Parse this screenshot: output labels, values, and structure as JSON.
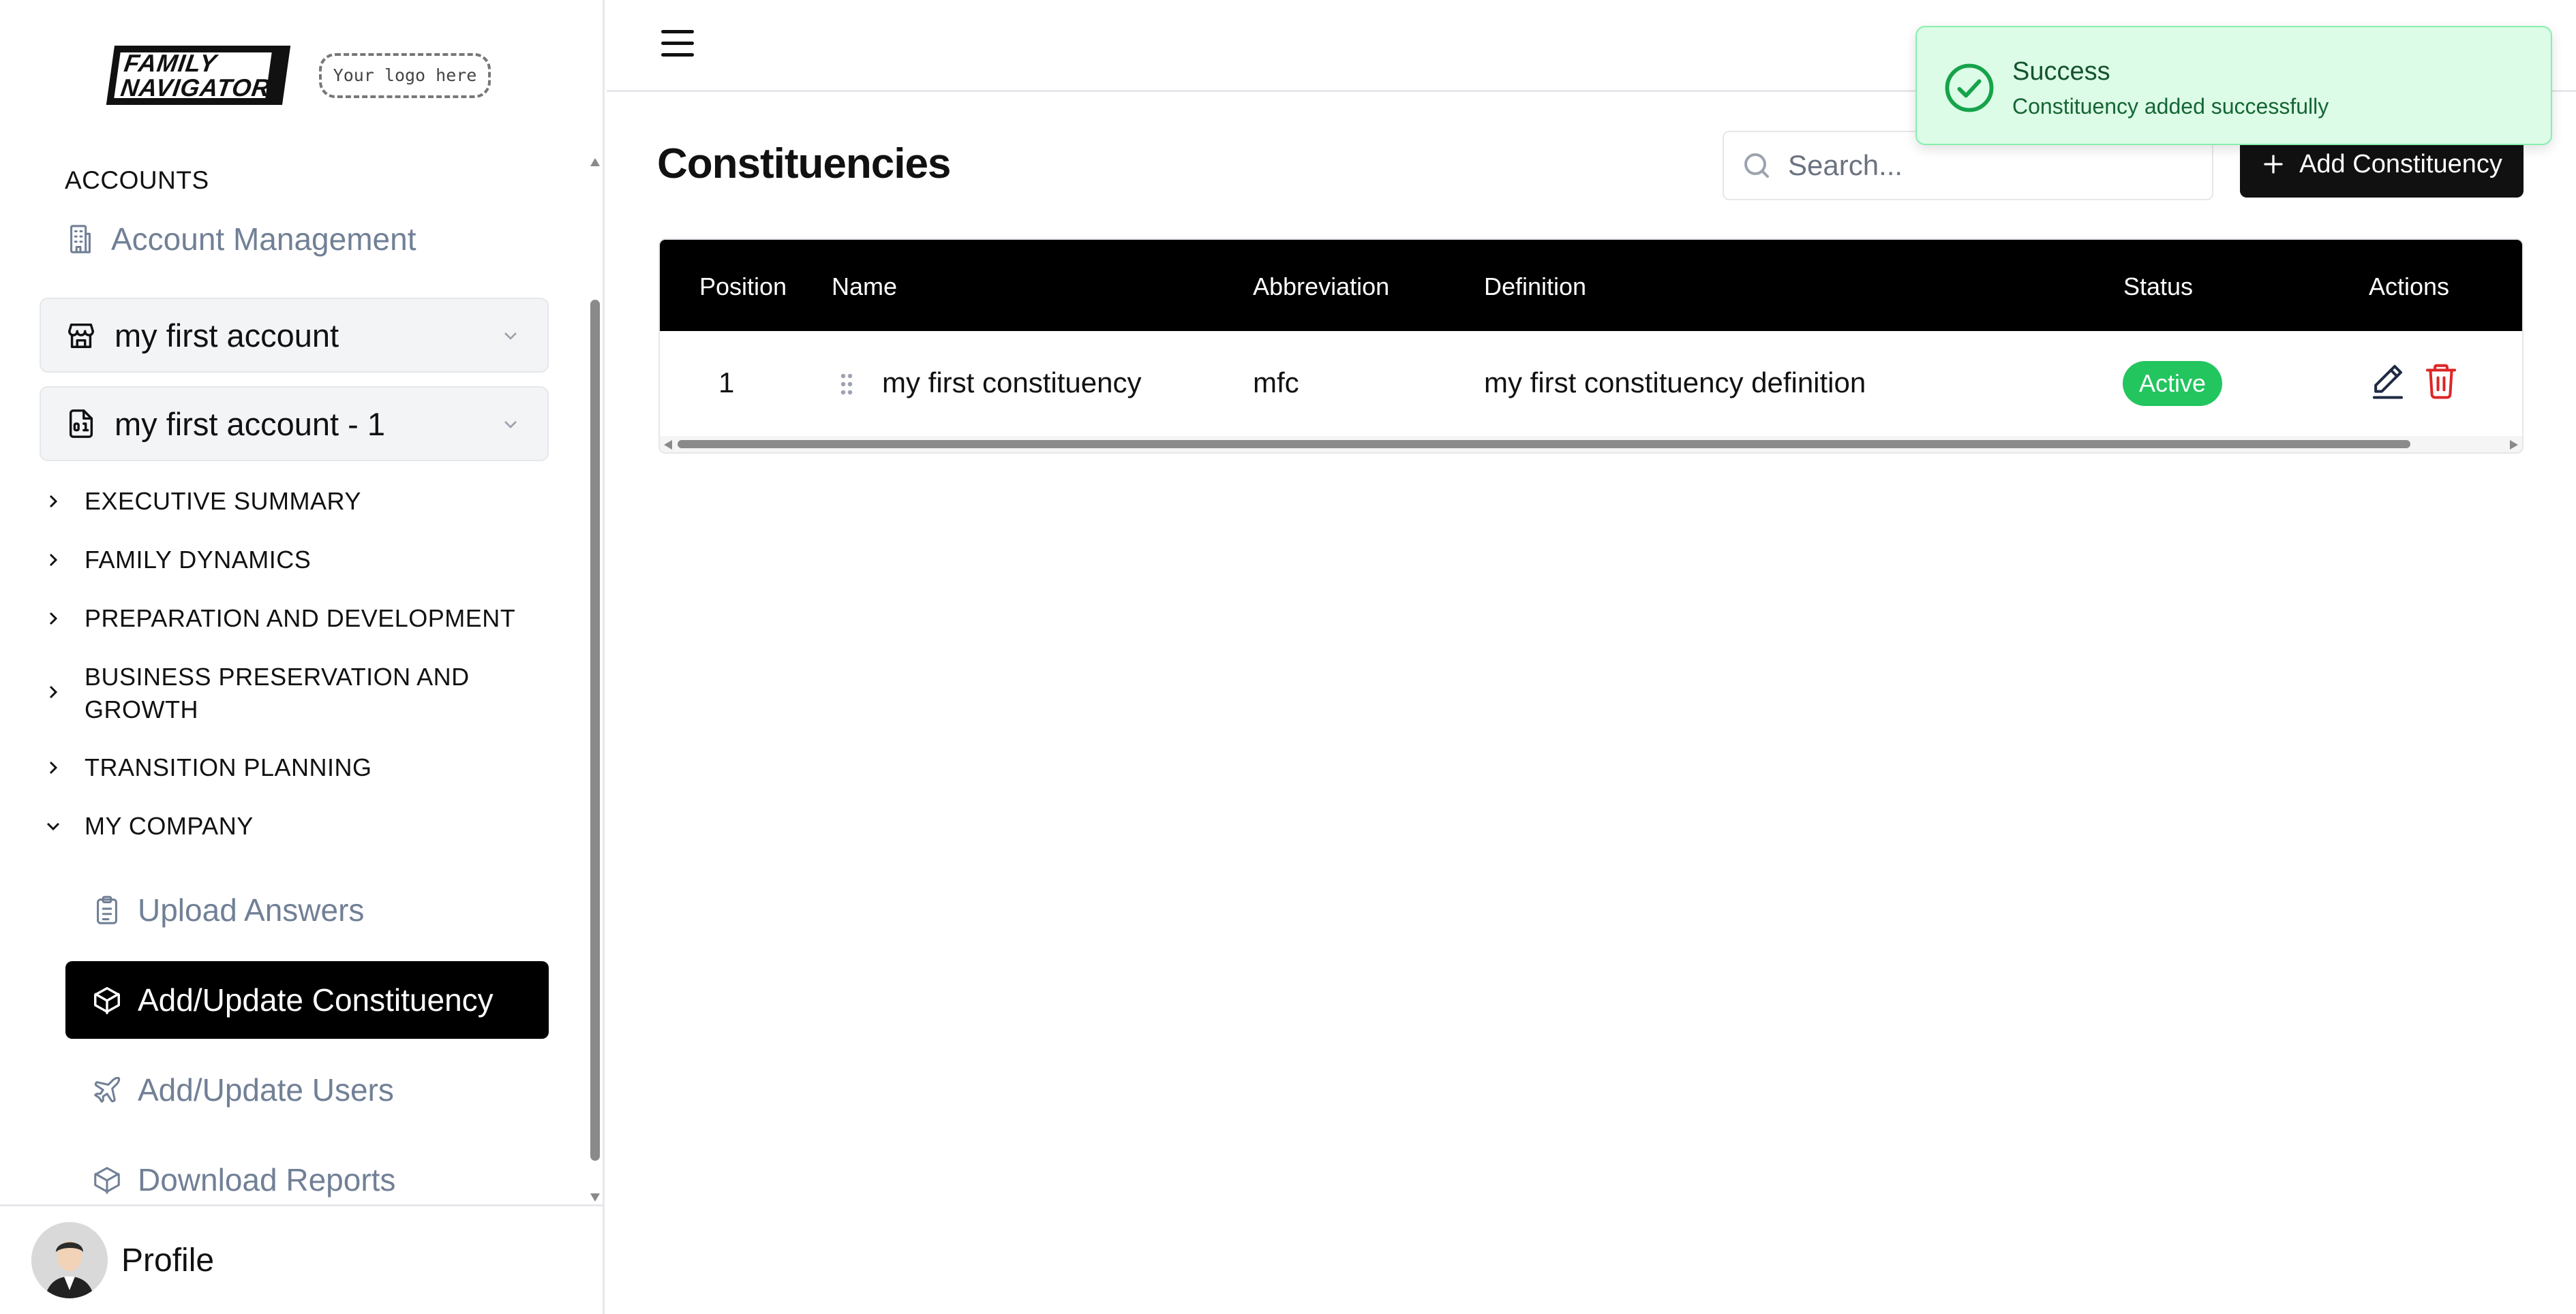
{
  "brand": {
    "logo_line1": "FAMILY",
    "logo_line2": "NAVIGATOR",
    "placeholder_logo": "Your logo here"
  },
  "sidebar": {
    "section_title": "ACCOUNTS",
    "account_management": "Account Management",
    "accounts": [
      {
        "label": "my first account"
      },
      {
        "label": "my first account - 1"
      }
    ],
    "tree": [
      {
        "label": "EXECUTIVE SUMMARY",
        "expanded": false
      },
      {
        "label": "FAMILY DYNAMICS",
        "expanded": false
      },
      {
        "label": "PREPARATION AND DEVELOPMENT",
        "expanded": false
      },
      {
        "label": "BUSINESS PRESERVATION AND",
        "label2": "GROWTH",
        "expanded": false
      },
      {
        "label": "TRANSITION PLANNING",
        "expanded": false
      },
      {
        "label": "MY COMPANY",
        "expanded": true
      }
    ],
    "sub_items": [
      {
        "label": "Upload Answers",
        "active": false
      },
      {
        "label": "Add/Update Constituency",
        "active": true
      },
      {
        "label": "Add/Update Users",
        "active": false
      },
      {
        "label": "Download Reports",
        "active": false
      }
    ],
    "profile_label": "Profile"
  },
  "main": {
    "title": "Constituencies",
    "search_placeholder": "Search...",
    "add_button_label": "Add Constituency",
    "table": {
      "headers": [
        "Position",
        "Name",
        "Abbreviation",
        "Definition",
        "Status",
        "Actions"
      ],
      "rows": [
        {
          "position": "1",
          "name": "my first constituency",
          "abbreviation": "mfc",
          "definition": "my first constituency definition",
          "status": "Active"
        }
      ]
    }
  },
  "toast": {
    "title": "Success",
    "message": "Constituency added successfully"
  },
  "colors": {
    "accent": "#000000",
    "status_active": "#22c55e",
    "danger": "#dc2626",
    "muted": "#718096",
    "toast_bg": "#dcfce7"
  }
}
